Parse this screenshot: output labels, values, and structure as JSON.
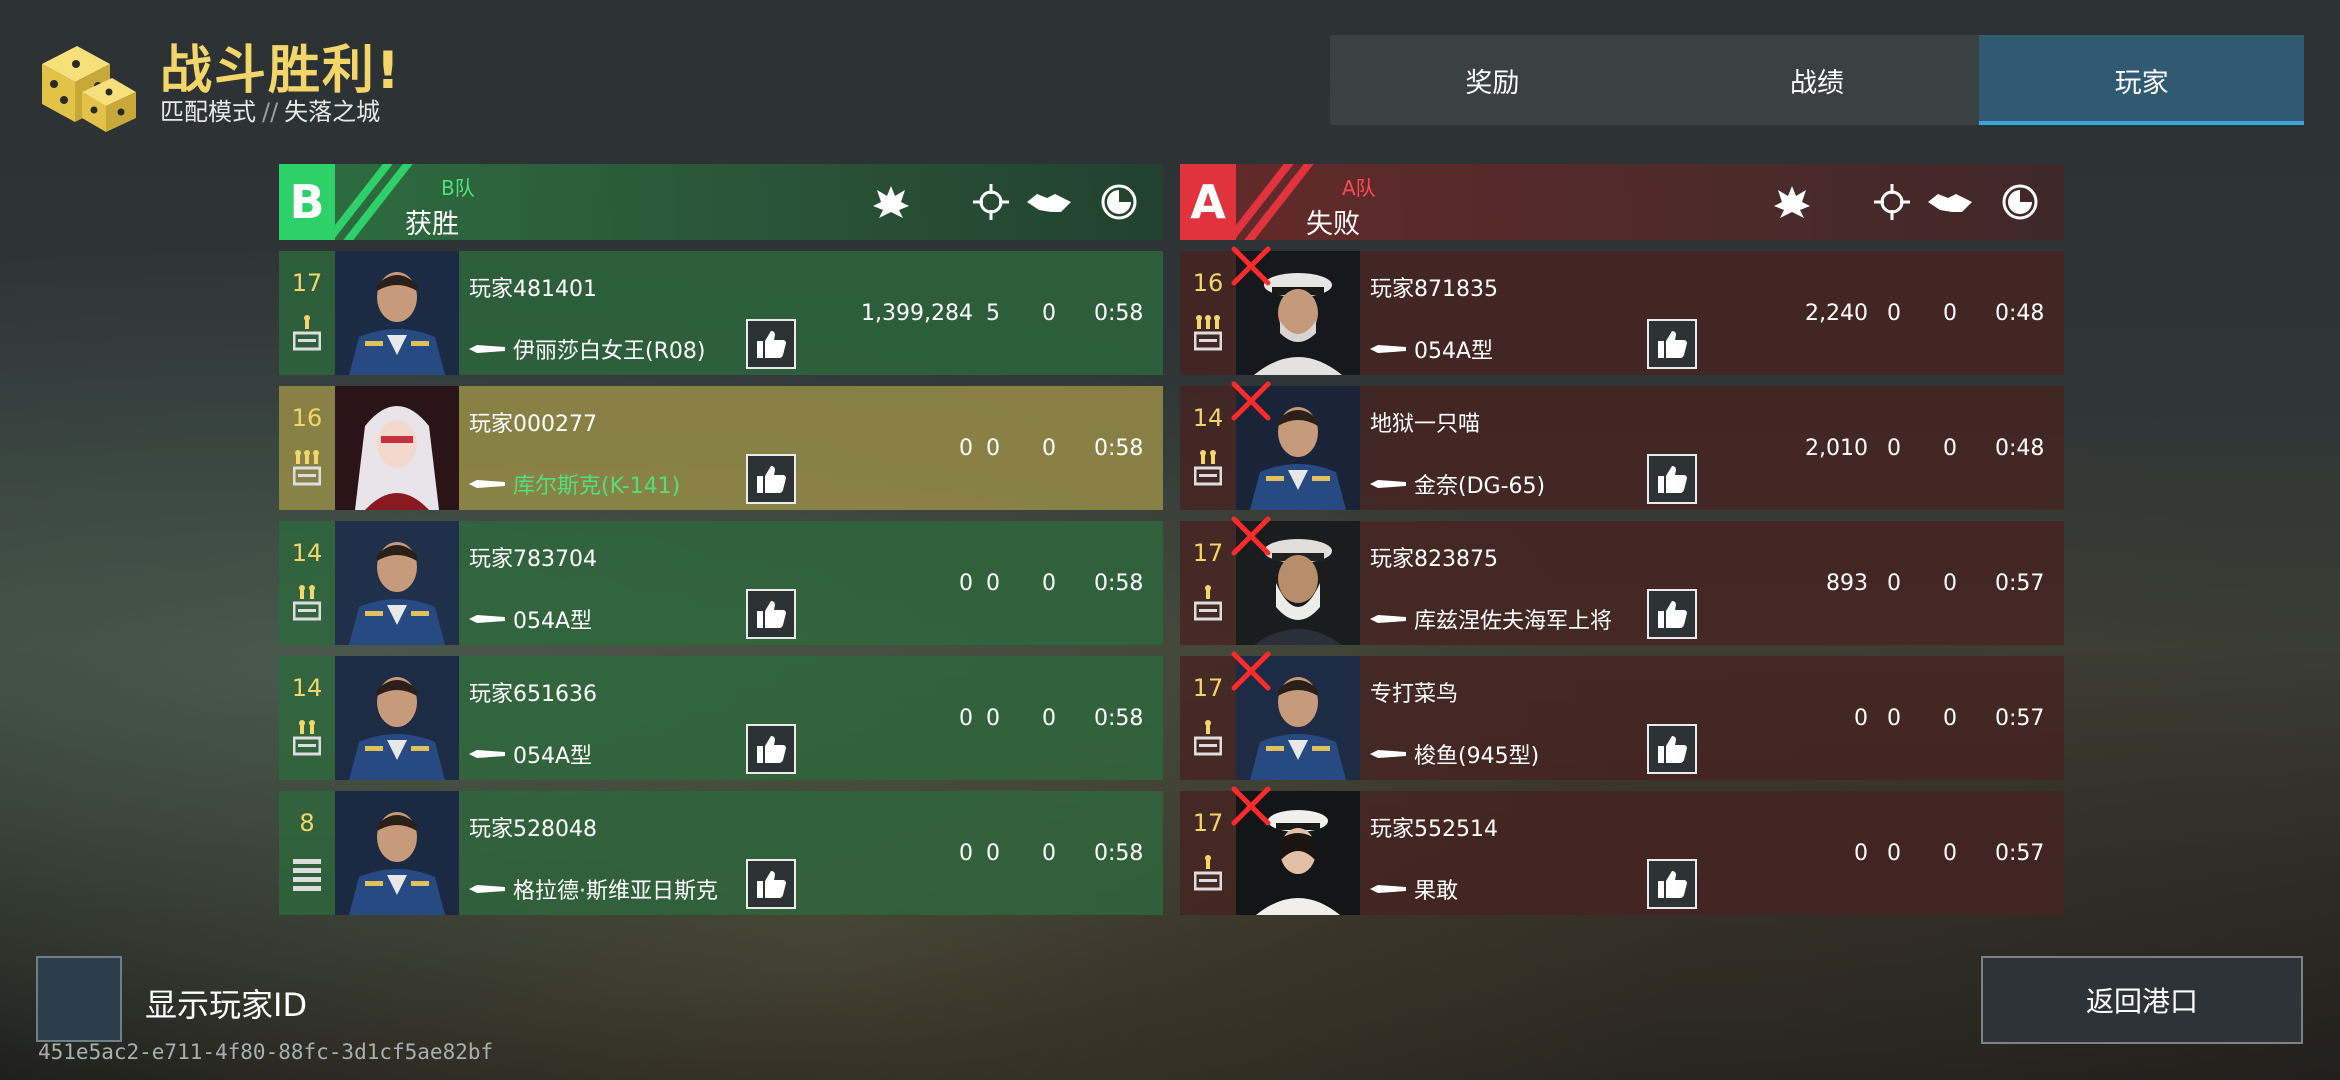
{
  "header": {
    "title": "战斗胜利!",
    "mode": "匹配模式",
    "separator": "//",
    "map": "失落之城"
  },
  "tabs": [
    {
      "label": "奖励",
      "active": false
    },
    {
      "label": "战绩",
      "active": false
    },
    {
      "label": "玩家",
      "active": true
    }
  ],
  "teams": {
    "left": {
      "badge": "B",
      "name": "B队",
      "result": "获胜",
      "color": "#2ed06a",
      "columns": [
        "damage-icon",
        "assist-icon",
        "cooperation-icon",
        "time-icon"
      ],
      "players": [
        {
          "level": "17",
          "rank": "rank-icon-1",
          "name": "玩家481401",
          "ship": "伊丽莎白女王(R08)",
          "damage": "1,399,284",
          "kills": "5",
          "assists": "0",
          "time": "0:58",
          "highlight": false
        },
        {
          "level": "16",
          "rank": "rank-icon-3",
          "name": "玩家000277",
          "ship": "库尔斯克(K-141)",
          "damage": "0",
          "kills": "0",
          "assists": "0",
          "time": "0:58",
          "highlight": true
        },
        {
          "level": "14",
          "rank": "rank-icon-2",
          "name": "玩家783704",
          "ship": "054A型",
          "damage": "0",
          "kills": "0",
          "assists": "0",
          "time": "0:58",
          "highlight": false
        },
        {
          "level": "14",
          "rank": "rank-icon-2",
          "name": "玩家651636",
          "ship": "054A型",
          "damage": "0",
          "kills": "0",
          "assists": "0",
          "time": "0:58",
          "highlight": false
        },
        {
          "level": "8",
          "rank": "rank-icon-stripes",
          "name": "玩家528048",
          "ship": "格拉德·斯维亚日斯克",
          "damage": "0",
          "kills": "0",
          "assists": "0",
          "time": "0:58",
          "highlight": false
        }
      ]
    },
    "right": {
      "badge": "A",
      "name": "A队",
      "result": "失败",
      "color": "#e0333d",
      "columns": [
        "damage-icon",
        "assist-icon",
        "cooperation-icon",
        "time-icon"
      ],
      "players": [
        {
          "level": "16",
          "rank": "rank-icon-3",
          "name": "玩家871835",
          "ship": "054A型",
          "damage": "2,240",
          "kills": "0",
          "assists": "0",
          "time": "0:48"
        },
        {
          "level": "14",
          "rank": "rank-icon-2",
          "name": "地狱一只喵",
          "ship": "金奈(DG-65)",
          "damage": "2,010",
          "kills": "0",
          "assists": "0",
          "time": "0:48"
        },
        {
          "level": "17",
          "rank": "rank-icon-1",
          "name": "玩家823875",
          "ship": "库兹涅佐夫海军上将",
          "damage": "893",
          "kills": "0",
          "assists": "0",
          "time": "0:57"
        },
        {
          "level": "17",
          "rank": "rank-icon-1",
          "name": "专打菜鸟",
          "ship": "梭鱼(945型)",
          "damage": "0",
          "kills": "0",
          "assists": "0",
          "time": "0:57"
        },
        {
          "level": "17",
          "rank": "rank-icon-1",
          "name": "玩家552514",
          "ship": "果敢",
          "damage": "0",
          "kills": "0",
          "assists": "0",
          "time": "0:57"
        }
      ]
    }
  },
  "footer": {
    "show_id_label": "显示玩家ID",
    "session_id": "451e5ac2-e711-4f80-88fc-3d1cf5ae82bf",
    "back_button": "返回港口"
  }
}
